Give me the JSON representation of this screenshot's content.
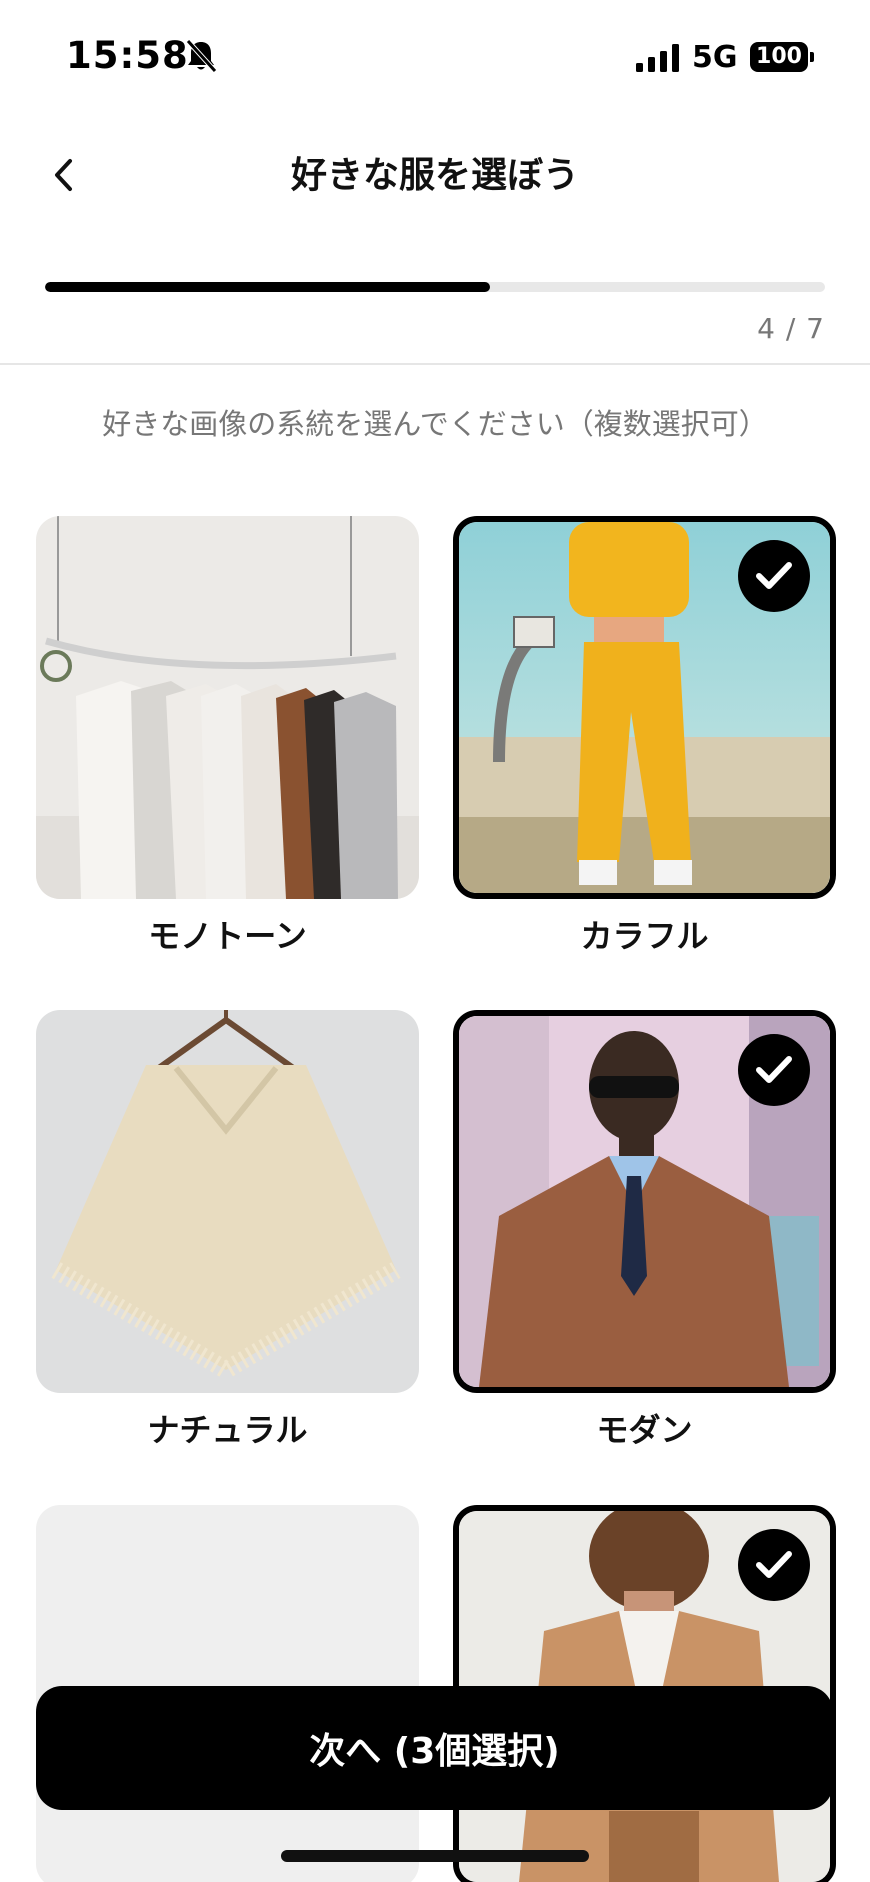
{
  "status_bar": {
    "time": "15:58",
    "network": "5G",
    "battery": "100",
    "icons": [
      "bell-slash-icon",
      "cellular-signal-icon",
      "battery-icon"
    ]
  },
  "header": {
    "title": "好きな服を選ぼう",
    "back_icon": "chevron-left-icon"
  },
  "progress": {
    "current": 4,
    "total": 7,
    "label": "4 / 7",
    "fill_fraction": 0.57
  },
  "instruction": "好きな画像の系統を選んでください（複数選択可）",
  "styles": [
    {
      "label": "モノトーン",
      "selected": false,
      "image": "white clothes on hangers"
    },
    {
      "label": "カラフル",
      "selected": true,
      "image": "yellow tracksuit on basketball court"
    },
    {
      "label": "ナチュラル",
      "selected": false,
      "image": "cream knit poncho on hanger"
    },
    {
      "label": "モダン",
      "selected": true,
      "image": "man in brown leather jacket and sunglasses"
    },
    {
      "label": "",
      "selected": false,
      "image": ""
    },
    {
      "label": "",
      "selected": true,
      "image": "man in camel coat sitting on stool"
    }
  ],
  "cta": {
    "label": "次へ (3個選択)"
  },
  "colors": {
    "accent": "#000000",
    "muted_text": "#777777",
    "track": "#e8e8e8"
  }
}
